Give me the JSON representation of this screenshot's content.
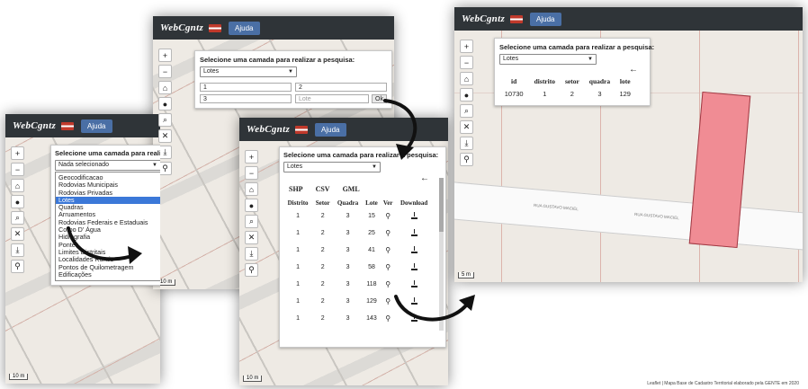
{
  "app": {
    "logo": "WebCgntz",
    "help_button": "Ajuda"
  },
  "panel1": {
    "title": "Selecione uma camada para realizar a pesquisa:",
    "select_value": "Nada selecionado",
    "options": [
      "Geocodificacao",
      "Rodovias Municipais",
      "Rodovias Privadas",
      "Lotes",
      "Quadras",
      "Arruamentos",
      "Rodovias Federais e Estaduais",
      "Corpo D' Água",
      "Hidrografia",
      "Pontes",
      "Limites Distritais",
      "Localidades Rurais",
      "Pontos de Quilometragem",
      "Edificações"
    ],
    "selected_index": 3,
    "scale": "10 m"
  },
  "panel2": {
    "title": "Selecione uma camada para realizar a pesquisa:",
    "select_value": "Lotes",
    "fields": [
      {
        "value": "1"
      },
      {
        "value": "2"
      },
      {
        "value": "3"
      },
      {
        "placeholder": "Lote"
      }
    ],
    "ok_button": "Ok",
    "scale": "10 m"
  },
  "panel3": {
    "title": "Selecione uma camada para realizar a pesquisa:",
    "select_value": "Lotes",
    "back_arrow": "←",
    "export": [
      "SHP",
      "CSV",
      "GML"
    ],
    "headers": [
      "Distrito",
      "Setor",
      "Quadra",
      "Lote",
      "Ver",
      "Download"
    ],
    "rows": [
      [
        "1",
        "2",
        "3",
        "15"
      ],
      [
        "1",
        "2",
        "3",
        "25"
      ],
      [
        "1",
        "2",
        "3",
        "41"
      ],
      [
        "1",
        "2",
        "3",
        "58"
      ],
      [
        "1",
        "2",
        "3",
        "118"
      ],
      [
        "1",
        "2",
        "3",
        "129"
      ],
      [
        "1",
        "2",
        "3",
        "143"
      ]
    ],
    "scale": "10 m"
  },
  "panel4": {
    "title": "Selecione uma camada para realizar a pesquisa:",
    "select_value": "Lotes",
    "back_arrow": "←",
    "headers": [
      "id",
      "distrito",
      "setor",
      "quadra",
      "lote"
    ],
    "row": [
      "10730",
      "1",
      "2",
      "3",
      "129"
    ],
    "scale": "5 m",
    "street": "RUA GUSTAVO MACIEL",
    "attribution": "Leaflet | Mapa Base de Cadastro Territorial elaborado pela GENTE em 2020"
  },
  "colors": {
    "topbar": "#2f3438",
    "help": "#4a6fa5",
    "selected": "#3b78d8",
    "lot": "#f08c94"
  }
}
